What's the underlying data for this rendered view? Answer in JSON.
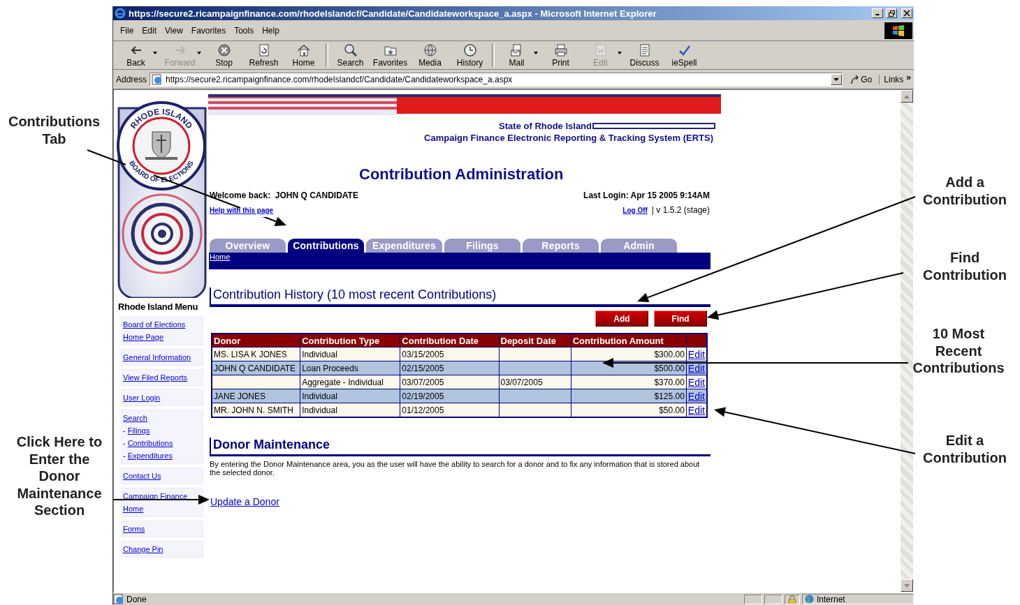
{
  "window": {
    "title": "https://secure2.ricampaignfinance.com/rhodeIslandcf/Candidate/Candidateworkspace_a.aspx - Microsoft Internet Explorer",
    "menu": [
      "File",
      "Edit",
      "View",
      "Favorites",
      "Tools",
      "Help"
    ],
    "toolbar": [
      {
        "label": "Back",
        "dropdown": true,
        "disabled": false
      },
      {
        "label": "Forward",
        "dropdown": true,
        "disabled": true
      },
      {
        "label": "Stop",
        "dropdown": false,
        "disabled": false
      },
      {
        "label": "Refresh",
        "dropdown": false,
        "disabled": false
      },
      {
        "label": "Home",
        "dropdown": false,
        "disabled": false
      },
      {
        "label": "Search",
        "dropdown": false,
        "disabled": false
      },
      {
        "label": "Favorites",
        "dropdown": false,
        "disabled": false
      },
      {
        "label": "Media",
        "dropdown": false,
        "disabled": false
      },
      {
        "label": "History",
        "dropdown": false,
        "disabled": false
      },
      {
        "label": "Mail",
        "dropdown": true,
        "disabled": false
      },
      {
        "label": "Print",
        "dropdown": false,
        "disabled": false
      },
      {
        "label": "Edit",
        "dropdown": true,
        "disabled": true
      },
      {
        "label": "Discuss",
        "dropdown": false,
        "disabled": false
      },
      {
        "label": "ieSpell",
        "dropdown": false,
        "disabled": false
      }
    ],
    "address_label": "Address",
    "url": "https://secure2.ricampaignfinance.com/rhodeIslandcf/Candidate/Candidateworkspace_a.aspx",
    "go": "Go",
    "links": "Links",
    "links_more": "»",
    "status": "Done",
    "zone": "Internet"
  },
  "site": {
    "logo_top": "RHODE ISLAND",
    "logo_bottom": "BOARD OF ELECTIONS",
    "state": "State of Rhode Island",
    "system": "Campaign Finance Electronic Reporting & Tracking System (ERTS)",
    "page_title": "Contribution Administration",
    "welcome": "Welcome back:  JOHN Q CANDIDATE",
    "last_login": "Last Login: Apr 15 2005 9:14AM",
    "help": "Help with this page",
    "logoff": "Log Off",
    "version": "| v 1.5.2 (stage)",
    "tabs": [
      {
        "label": "Overview",
        "selected": false
      },
      {
        "label": "Contributions",
        "selected": true
      },
      {
        "label": "Expenditures",
        "selected": false
      },
      {
        "label": "Filings",
        "selected": false
      },
      {
        "label": "Reports",
        "selected": false
      },
      {
        "label": "Admin",
        "selected": false
      }
    ],
    "breadcrumb": "Home",
    "menu_title": "Rhode Island Menu",
    "menu": [
      {
        "items": [
          {
            "label": "Board of Elections"
          },
          {
            "label": "Home Page"
          }
        ]
      },
      {
        "items": [
          {
            "label": "General Information"
          }
        ]
      },
      {
        "items": [
          {
            "label": "View Filed Reports"
          }
        ]
      },
      {
        "items": [
          {
            "label": "User Login"
          }
        ]
      },
      {
        "items": [
          {
            "label": "Search"
          },
          {
            "bullet": "-",
            "label": "Filings"
          },
          {
            "bullet": "-",
            "label": "Contributions"
          },
          {
            "bullet": "-",
            "label": "Expenditures"
          }
        ]
      },
      {
        "items": [
          {
            "label": "Contact Us"
          }
        ]
      },
      {
        "items": [
          {
            "label": "Campaign Finance"
          },
          {
            "label": "Home"
          }
        ]
      },
      {
        "items": [
          {
            "label": "Forms"
          }
        ]
      },
      {
        "items": [
          {
            "label": "Change Pin"
          }
        ]
      }
    ],
    "history": {
      "title": "Contribution History (10 most recent Contributions)",
      "buttons": [
        "Add",
        "Find"
      ],
      "columns": [
        "Donor",
        "Contribution Type",
        "Contribution Date",
        "Deposit Date",
        "Contribution Amount"
      ],
      "rows": [
        {
          "donor": "MS. LISA K JONES",
          "type": "Individual",
          "date": "03/15/2005",
          "amount": "$300.00",
          "action": "Edit"
        },
        {
          "donor": "JOHN Q CANDIDATE",
          "type": "Loan Proceeds",
          "date": "02/15/2005",
          "amount": "$500.00",
          "action": "Edit"
        },
        {
          "type": "Aggregate - Individual",
          "date": "03/07/2005",
          "deposit": "03/07/2005",
          "amount": "$370.00",
          "action": "Edit"
        },
        {
          "donor": "JANE JONES",
          "type": "Individual",
          "date": "02/19/2005",
          "amount": "$125.00",
          "action": "Edit"
        },
        {
          "donor": "MR. JOHN N. SMITH",
          "type": "Individual",
          "date": "01/12/2005",
          "amount": "$50.00",
          "action": "Edit"
        }
      ]
    },
    "donor": {
      "title": "Donor Maintenance",
      "text": "By entering the Donor Maintenance area, you as the user will have the ability to search for a donor and to fix any information that is stored about the selected donor.",
      "link": "Update a Donor"
    }
  },
  "annotations": [
    {
      "text": "Contributions Tab"
    },
    {
      "text": "Add a Contribution"
    },
    {
      "text": "Find Contribution"
    },
    {
      "text": "10 Most Recent Contributions"
    },
    {
      "text": "Click Here to Enter the Donor Maintenance Section"
    },
    {
      "text": "Edit a Contribution"
    }
  ]
}
